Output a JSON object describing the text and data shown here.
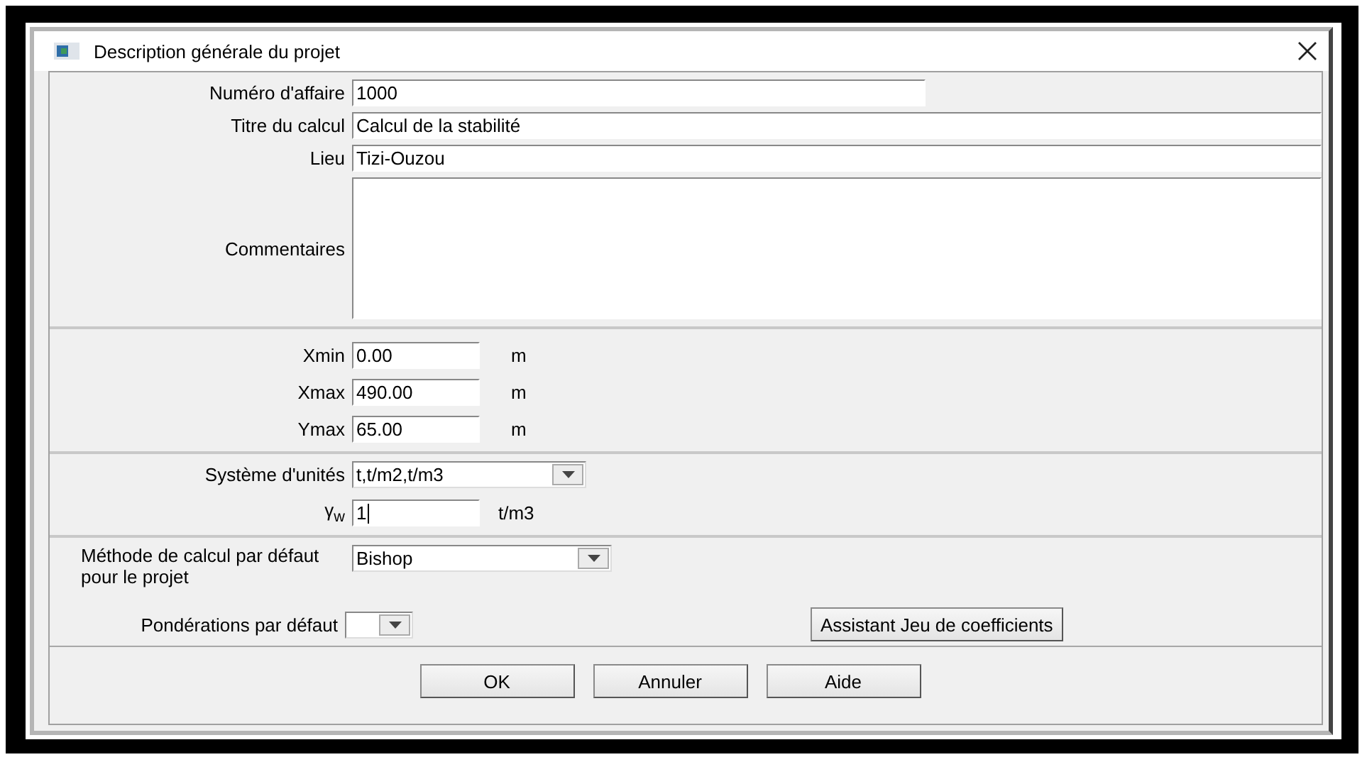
{
  "window": {
    "title": "Description générale du projet"
  },
  "project": [
    {
      "label": "Numéro d'affaire",
      "value": "1000",
      "kind": "short"
    },
    {
      "label": "Titre du calcul",
      "value": "Calcul de la stabilité",
      "kind": "wide"
    },
    {
      "label": "Lieu",
      "value": "Tizi-Ouzou",
      "kind": "wide"
    },
    {
      "label": "Commentaires",
      "kind": "area"
    }
  ],
  "extents": [
    {
      "label": "Xmin",
      "value": "0.00",
      "unit": "m"
    },
    {
      "label": "Xmax",
      "value": "490.00",
      "unit": "m"
    },
    {
      "label": "Ymax",
      "value": "65.00",
      "unit": "m"
    }
  ],
  "units": {
    "system": {
      "label": "Système d'unités",
      "value": "t,t/m2,t/m3"
    },
    "gamma_w": {
      "label": "γ$_{w}$",
      "value": "1",
      "unit": "t/m3",
      "focused": true
    }
  },
  "method": {
    "label": "Méthode de calcul par défaut pour le projet",
    "value": "Bishop"
  },
  "weights": {
    "label": "Pondérations par défaut"
  },
  "assistant_button": "Assistant Jeu de coefficients",
  "buttons": [
    "OK",
    "Annuler",
    "Aide"
  ]
}
